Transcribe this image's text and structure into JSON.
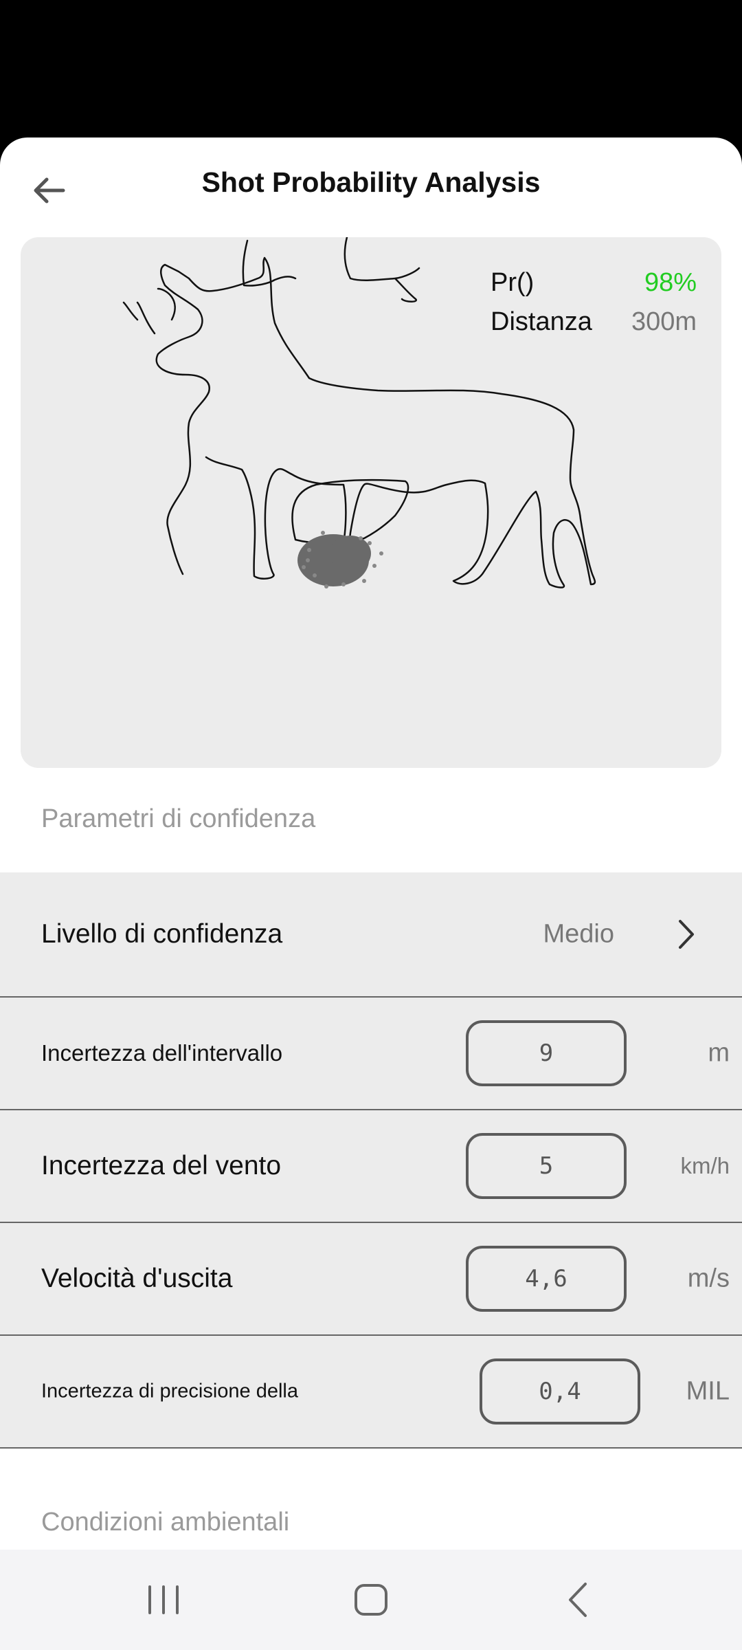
{
  "header": {
    "title": "Shot Probability Analysis"
  },
  "target": {
    "probability_label": "Pr()",
    "probability_value": "98%",
    "distance_label": "Distanza",
    "distance_value": "300m",
    "probability_color": "#22cc22"
  },
  "sections": {
    "confidence_title": "Parametri di confidenza",
    "environment_title": "Condizioni ambientali"
  },
  "confidence": {
    "level_label": "Livello di confidenza",
    "level_value": "Medio",
    "range_label": "Incertezza dell'intervallo",
    "range_value": "9",
    "range_unit": "m",
    "wind_label": "Incertezza del vento",
    "wind_value": "5",
    "wind_unit": "km/h",
    "muzzle_label": "Velocità d'uscita",
    "muzzle_value": "4,6",
    "muzzle_unit": "m/s",
    "precision_label": "Incertezza di precisione della",
    "precision_value": "0,4",
    "precision_unit": "MIL"
  },
  "icons": {
    "back": "arrow-left-icon",
    "chevron": "chevron-right-icon",
    "nav_recent": "recent-apps-icon",
    "nav_home": "home-icon",
    "nav_back": "back-icon"
  }
}
